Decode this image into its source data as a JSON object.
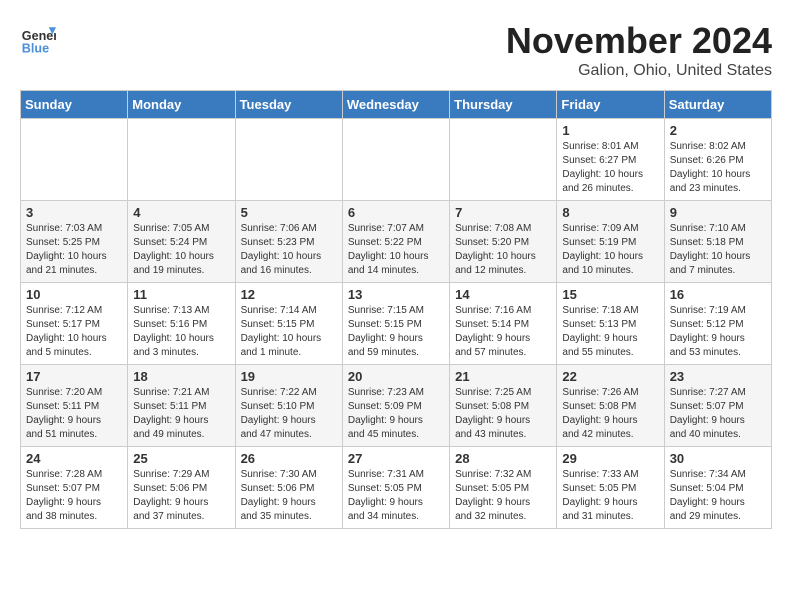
{
  "header": {
    "logo_line1": "General",
    "logo_line2": "Blue",
    "title": "November 2024",
    "subtitle": "Galion, Ohio, United States"
  },
  "weekdays": [
    "Sunday",
    "Monday",
    "Tuesday",
    "Wednesday",
    "Thursday",
    "Friday",
    "Saturday"
  ],
  "weeks": [
    [
      {
        "day": "",
        "info": ""
      },
      {
        "day": "",
        "info": ""
      },
      {
        "day": "",
        "info": ""
      },
      {
        "day": "",
        "info": ""
      },
      {
        "day": "",
        "info": ""
      },
      {
        "day": "1",
        "info": "Sunrise: 8:01 AM\nSunset: 6:27 PM\nDaylight: 10 hours\nand 26 minutes."
      },
      {
        "day": "2",
        "info": "Sunrise: 8:02 AM\nSunset: 6:26 PM\nDaylight: 10 hours\nand 23 minutes."
      }
    ],
    [
      {
        "day": "3",
        "info": "Sunrise: 7:03 AM\nSunset: 5:25 PM\nDaylight: 10 hours\nand 21 minutes."
      },
      {
        "day": "4",
        "info": "Sunrise: 7:05 AM\nSunset: 5:24 PM\nDaylight: 10 hours\nand 19 minutes."
      },
      {
        "day": "5",
        "info": "Sunrise: 7:06 AM\nSunset: 5:23 PM\nDaylight: 10 hours\nand 16 minutes."
      },
      {
        "day": "6",
        "info": "Sunrise: 7:07 AM\nSunset: 5:22 PM\nDaylight: 10 hours\nand 14 minutes."
      },
      {
        "day": "7",
        "info": "Sunrise: 7:08 AM\nSunset: 5:20 PM\nDaylight: 10 hours\nand 12 minutes."
      },
      {
        "day": "8",
        "info": "Sunrise: 7:09 AM\nSunset: 5:19 PM\nDaylight: 10 hours\nand 10 minutes."
      },
      {
        "day": "9",
        "info": "Sunrise: 7:10 AM\nSunset: 5:18 PM\nDaylight: 10 hours\nand 7 minutes."
      }
    ],
    [
      {
        "day": "10",
        "info": "Sunrise: 7:12 AM\nSunset: 5:17 PM\nDaylight: 10 hours\nand 5 minutes."
      },
      {
        "day": "11",
        "info": "Sunrise: 7:13 AM\nSunset: 5:16 PM\nDaylight: 10 hours\nand 3 minutes."
      },
      {
        "day": "12",
        "info": "Sunrise: 7:14 AM\nSunset: 5:15 PM\nDaylight: 10 hours\nand 1 minute."
      },
      {
        "day": "13",
        "info": "Sunrise: 7:15 AM\nSunset: 5:15 PM\nDaylight: 9 hours\nand 59 minutes."
      },
      {
        "day": "14",
        "info": "Sunrise: 7:16 AM\nSunset: 5:14 PM\nDaylight: 9 hours\nand 57 minutes."
      },
      {
        "day": "15",
        "info": "Sunrise: 7:18 AM\nSunset: 5:13 PM\nDaylight: 9 hours\nand 55 minutes."
      },
      {
        "day": "16",
        "info": "Sunrise: 7:19 AM\nSunset: 5:12 PM\nDaylight: 9 hours\nand 53 minutes."
      }
    ],
    [
      {
        "day": "17",
        "info": "Sunrise: 7:20 AM\nSunset: 5:11 PM\nDaylight: 9 hours\nand 51 minutes."
      },
      {
        "day": "18",
        "info": "Sunrise: 7:21 AM\nSunset: 5:11 PM\nDaylight: 9 hours\nand 49 minutes."
      },
      {
        "day": "19",
        "info": "Sunrise: 7:22 AM\nSunset: 5:10 PM\nDaylight: 9 hours\nand 47 minutes."
      },
      {
        "day": "20",
        "info": "Sunrise: 7:23 AM\nSunset: 5:09 PM\nDaylight: 9 hours\nand 45 minutes."
      },
      {
        "day": "21",
        "info": "Sunrise: 7:25 AM\nSunset: 5:08 PM\nDaylight: 9 hours\nand 43 minutes."
      },
      {
        "day": "22",
        "info": "Sunrise: 7:26 AM\nSunset: 5:08 PM\nDaylight: 9 hours\nand 42 minutes."
      },
      {
        "day": "23",
        "info": "Sunrise: 7:27 AM\nSunset: 5:07 PM\nDaylight: 9 hours\nand 40 minutes."
      }
    ],
    [
      {
        "day": "24",
        "info": "Sunrise: 7:28 AM\nSunset: 5:07 PM\nDaylight: 9 hours\nand 38 minutes."
      },
      {
        "day": "25",
        "info": "Sunrise: 7:29 AM\nSunset: 5:06 PM\nDaylight: 9 hours\nand 37 minutes."
      },
      {
        "day": "26",
        "info": "Sunrise: 7:30 AM\nSunset: 5:06 PM\nDaylight: 9 hours\nand 35 minutes."
      },
      {
        "day": "27",
        "info": "Sunrise: 7:31 AM\nSunset: 5:05 PM\nDaylight: 9 hours\nand 34 minutes."
      },
      {
        "day": "28",
        "info": "Sunrise: 7:32 AM\nSunset: 5:05 PM\nDaylight: 9 hours\nand 32 minutes."
      },
      {
        "day": "29",
        "info": "Sunrise: 7:33 AM\nSunset: 5:05 PM\nDaylight: 9 hours\nand 31 minutes."
      },
      {
        "day": "30",
        "info": "Sunrise: 7:34 AM\nSunset: 5:04 PM\nDaylight: 9 hours\nand 29 minutes."
      }
    ]
  ]
}
